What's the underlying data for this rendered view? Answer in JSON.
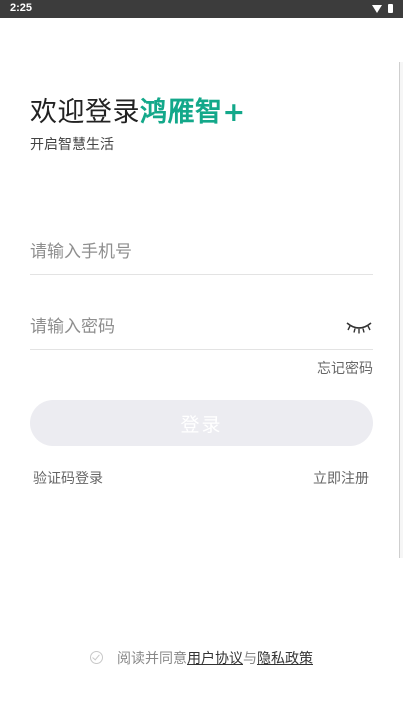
{
  "status_bar": {
    "time": "2:25",
    "icons": [
      "wifi-icon",
      "battery-icon"
    ]
  },
  "header": {
    "welcome": "欢迎登录",
    "brand": "鸿雁智+",
    "subtitle": "开启智慧生活"
  },
  "form": {
    "phone_placeholder": "请输入手机号",
    "password_placeholder": "请输入密码",
    "password_toggle_icon": "eye-closed-icon",
    "forgot_password": "忘记密码",
    "login_button": "登录",
    "sms_login": "验证码登录",
    "register": "立即注册"
  },
  "agreement": {
    "prefix": "阅读并同意",
    "terms": "用户协议",
    "and": "与",
    "privacy": "隐私政策"
  },
  "colors": {
    "brand": "#13a88a",
    "button_disabled": "#ececf1",
    "status_bar": "#3c3c3c"
  }
}
